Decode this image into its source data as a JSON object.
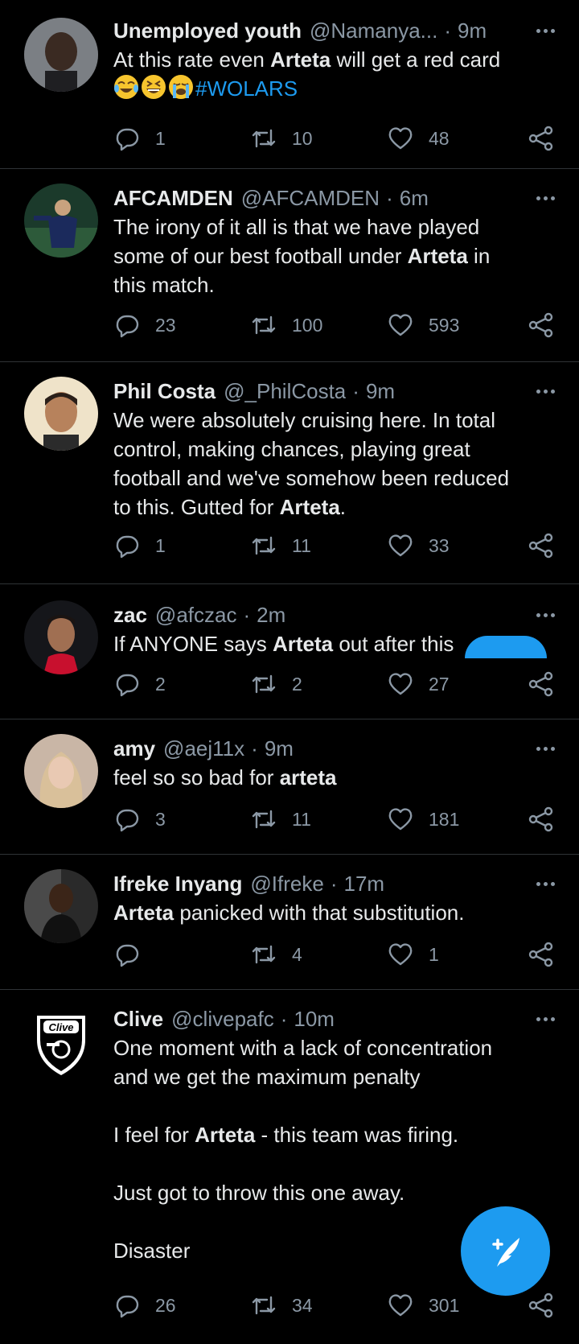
{
  "colors": {
    "background": "#000000",
    "accent": "#1d9bf0",
    "muted": "#8b98a5",
    "divider": "#2f3336"
  },
  "tweets": [
    {
      "name": "Unemployed youth",
      "handle": "@Namanya...",
      "time": "9m",
      "text_parts": [
        {
          "t": "At this rate even "
        },
        {
          "t": "Arteta",
          "bold": true
        },
        {
          "t": " will get a red card\n"
        },
        {
          "emoji": "face-with-tears-of-joy"
        },
        {
          "emoji": "grinning-squinting-face"
        },
        {
          "emoji": "loudly-crying-face"
        },
        {
          "t": "#WOLARS",
          "link": true
        }
      ],
      "replies": "1",
      "retweets": "10",
      "likes": "48"
    },
    {
      "name": "AFCAMDEN",
      "handle": "@AFCAMDEN",
      "time": "6m",
      "text_parts": [
        {
          "t": "The irony of it all is that we have played\nsome of our best football under "
        },
        {
          "t": "Arteta",
          "bold": true
        },
        {
          "t": " in\nthis match."
        }
      ],
      "replies": "23",
      "retweets": "100",
      "likes": "593"
    },
    {
      "name": "Phil Costa",
      "handle": "@_PhilCosta",
      "time": "9m",
      "text_parts": [
        {
          "t": "We were absolutely cruising here. In total\ncontrol, making chances, playing great\nfootball and we've somehow been reduced\nto this. Gutted for "
        },
        {
          "t": "Arteta",
          "bold": true
        },
        {
          "t": "."
        }
      ],
      "replies": "1",
      "retweets": "11",
      "likes": "33"
    },
    {
      "name": "zac",
      "handle": "@afczac",
      "time": "2m",
      "text_parts": [
        {
          "t": "If ANYONE says "
        },
        {
          "t": "Arteta",
          "bold": true
        },
        {
          "t": " out after this"
        }
      ],
      "replies": "2",
      "retweets": "2",
      "likes": "27"
    },
    {
      "name": "amy",
      "handle": "@aej11x",
      "time": "9m",
      "text_parts": [
        {
          "t": "feel so so bad for "
        },
        {
          "t": "arteta",
          "bold": true
        }
      ],
      "replies": "3",
      "retweets": "11",
      "likes": "181"
    },
    {
      "name": "Ifreke Inyang",
      "handle": "@Ifreke",
      "time": "17m",
      "text_parts": [
        {
          "t": "Arteta",
          "bold": true
        },
        {
          "t": " panicked with that substitution."
        }
      ],
      "replies": "",
      "retweets": "4",
      "likes": "1"
    },
    {
      "name": "Clive",
      "handle": "@clivepafc",
      "time": "10m",
      "avatar_text": "Clive",
      "text_parts": [
        {
          "t": "One moment with a lack of concentration\nand we get the maximum penalty\n\nI feel for "
        },
        {
          "t": "Arteta",
          "bold": true
        },
        {
          "t": " - this team was firing.\n\nJust got to throw this one away.\n\nDisaster"
        }
      ],
      "replies": "26",
      "retweets": "34",
      "likes": "301"
    }
  ],
  "icons": {
    "reply": "reply-icon",
    "retweet": "retweet-icon",
    "like": "heart-icon",
    "share": "share-icon",
    "more": "more-icon",
    "compose": "compose-tweet-icon"
  }
}
